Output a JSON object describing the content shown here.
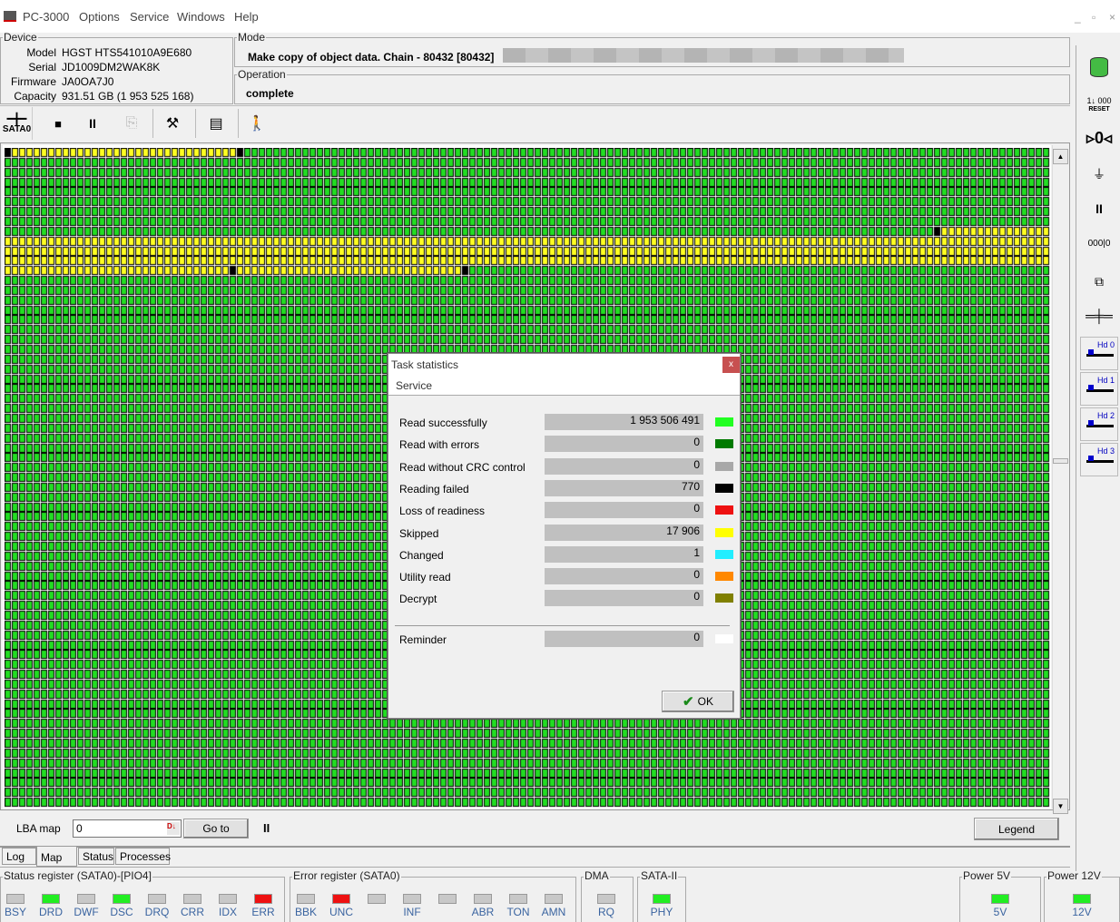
{
  "menu": {
    "app": "PC-3000",
    "items": [
      "Options",
      "Service",
      "Windows",
      "Help"
    ]
  },
  "window_controls": {
    "minimize": "_",
    "restore": "▫",
    "close": "×"
  },
  "device": {
    "legend": "Device",
    "model_label": "Model",
    "model": "HGST HTS541010A9E680",
    "serial_label": "Serial",
    "serial": "JD1009DM2WAK8K",
    "firmware_label": "Firmware",
    "firmware": "JA0OA7J0",
    "capacity_label": "Capacity",
    "capacity": "931.51 GB (1 953 525 168)"
  },
  "mode": {
    "legend": "Mode",
    "text": "Make copy of object data. Chain - 80432 [80432]"
  },
  "operation": {
    "legend": "Operation",
    "text": "complete"
  },
  "toolbar": {
    "port_label": "SATA0",
    "stop": "■",
    "pause": "II"
  },
  "map": {
    "columns": 144,
    "rows": 67,
    "default_color": "green",
    "colors": {
      "green": "#22dd22",
      "yellow": "#ffff22",
      "black": "#000000"
    },
    "runs": [
      {
        "row": 0,
        "from": 0,
        "to": 0,
        "color": "black"
      },
      {
        "row": 0,
        "from": 1,
        "to": 31,
        "color": "yellow"
      },
      {
        "row": 0,
        "from": 32,
        "to": 32,
        "color": "black"
      },
      {
        "row": 8,
        "from": 128,
        "to": 128,
        "color": "black"
      },
      {
        "row": 8,
        "from": 129,
        "to": 143,
        "color": "yellow"
      },
      {
        "row": 9,
        "from": 0,
        "to": 143,
        "color": "yellow"
      },
      {
        "row": 10,
        "from": 0,
        "to": 143,
        "color": "yellow"
      },
      {
        "row": 11,
        "from": 0,
        "to": 143,
        "color": "yellow"
      },
      {
        "row": 12,
        "from": 0,
        "to": 62,
        "color": "yellow"
      },
      {
        "row": 12,
        "from": 31,
        "to": 31,
        "color": "black"
      },
      {
        "row": 12,
        "from": 63,
        "to": 63,
        "color": "black"
      }
    ]
  },
  "lba": {
    "label": "LBA map",
    "value": "0",
    "goto": "Go to",
    "pause": "II",
    "legend": "Legend"
  },
  "tabs": [
    "Log",
    "Map",
    "Status",
    "Processes"
  ],
  "dialog": {
    "title": "Task statistics",
    "close": "x",
    "menu": "Service",
    "rows": [
      {
        "label": "Read successfully",
        "value": "1 953 506 491",
        "color": "#22ff22"
      },
      {
        "label": "Read with errors",
        "value": "0",
        "color": "#007a00"
      },
      {
        "label": "Read without CRC control",
        "value": "0",
        "color": "#a8a8a8"
      },
      {
        "label": "Reading failed",
        "value": "770",
        "color": "#000000"
      },
      {
        "label": "Loss of readiness",
        "value": "0",
        "color": "#ee1111"
      },
      {
        "label": "Skipped",
        "value": "17 906",
        "color": "#ffff00"
      },
      {
        "label": "Changed",
        "value": "1",
        "color": "#22eeff"
      },
      {
        "label": "Utility read",
        "value": "0",
        "color": "#ff8800"
      },
      {
        "label": "Decrypt",
        "value": "0",
        "color": "#808000"
      }
    ],
    "reminder": {
      "label": "Reminder",
      "value": "0",
      "color": "#ffffff"
    },
    "ok": "OK"
  },
  "status_register": {
    "title": "Status register (SATA0)-[PIO4]",
    "leds": [
      {
        "label": "BSY",
        "color": "#c8c8c8"
      },
      {
        "label": "DRD",
        "color": "#22ee22"
      },
      {
        "label": "DWF",
        "color": "#c8c8c8"
      },
      {
        "label": "DSC",
        "color": "#22ee22"
      },
      {
        "label": "DRQ",
        "color": "#c8c8c8"
      },
      {
        "label": "CRR",
        "color": "#c8c8c8"
      },
      {
        "label": "IDX",
        "color": "#c8c8c8"
      },
      {
        "label": "ERR",
        "color": "#ee1111"
      }
    ]
  },
  "error_register": {
    "title": "Error register (SATA0)",
    "leds": [
      {
        "label": "BBK",
        "color": "#c8c8c8"
      },
      {
        "label": "UNC",
        "color": "#ee1111"
      },
      {
        "label": "",
        "color": "#c8c8c8"
      },
      {
        "label": "INF",
        "color": "#c8c8c8"
      },
      {
        "label": "",
        "color": "#c8c8c8"
      },
      {
        "label": "ABR",
        "color": "#c8c8c8"
      },
      {
        "label": "TON",
        "color": "#c8c8c8"
      },
      {
        "label": "AMN",
        "color": "#c8c8c8"
      }
    ]
  },
  "dma": {
    "title": "DMA",
    "led": "RQ",
    "color": "#c8c8c8"
  },
  "sata": {
    "title": "SATA-II",
    "led": "PHY",
    "color": "#22ee22"
  },
  "power5": {
    "title": "Power 5V",
    "led": "5V",
    "color": "#22ee22"
  },
  "power12": {
    "title": "Power 12V",
    "led": "12V",
    "color": "#22ee22"
  },
  "right_toolbar": {
    "reset_label": "RESET",
    "heads": [
      "Hd 0",
      "Hd 1",
      "Hd 2",
      "Hd 3"
    ]
  }
}
